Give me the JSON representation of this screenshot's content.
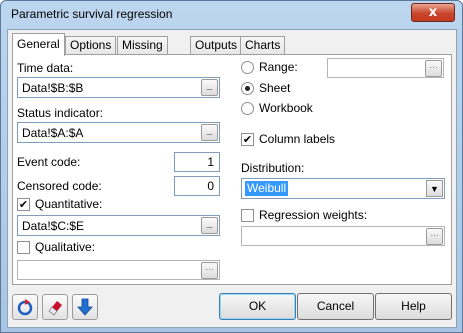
{
  "window": {
    "title": "Parametric survival regression",
    "close_label": "x"
  },
  "tabs": [
    {
      "label": "General"
    },
    {
      "label": "Options"
    },
    {
      "label": "Missing data"
    },
    {
      "label": "Outputs"
    },
    {
      "label": "Charts"
    }
  ],
  "general": {
    "time_data_label": "Time data:",
    "time_data_value": "Data!$B:$B",
    "status_label": "Status indicator:",
    "status_value": "Data!$A:$A",
    "event_code_label": "Event code:",
    "event_code_value": "1",
    "censored_code_label": "Censored code:",
    "censored_code_value": "0",
    "quantitative_label": "Quantitative:",
    "quantitative_checked": true,
    "quantitative_value": "Data!$C:$E",
    "qualitative_label": "Qualitative:",
    "qualitative_checked": false,
    "qualitative_value": "",
    "range_label": "Range:",
    "range_value": "",
    "sheet_label": "Sheet",
    "workbook_label": "Workbook",
    "selected_output": "Sheet",
    "column_labels_label": "Column labels",
    "column_labels_checked": true,
    "distribution_label": "Distribution:",
    "distribution_value": "Weibull",
    "regression_weights_label": "Regression weights:",
    "regression_weights_checked": false,
    "regression_weights_value": "",
    "ref_button_glyph": "_",
    "ref_button_disabled_glyph": "..."
  },
  "footer": {
    "ok_label": "OK",
    "cancel_label": "Cancel",
    "help_label": "Help",
    "icons": [
      "reset-icon",
      "eraser-icon",
      "arrow-down-icon"
    ]
  },
  "colors": {
    "title_bar": "#bcd6ef",
    "selection": "#3399ff",
    "close_button": "#c9462c"
  }
}
